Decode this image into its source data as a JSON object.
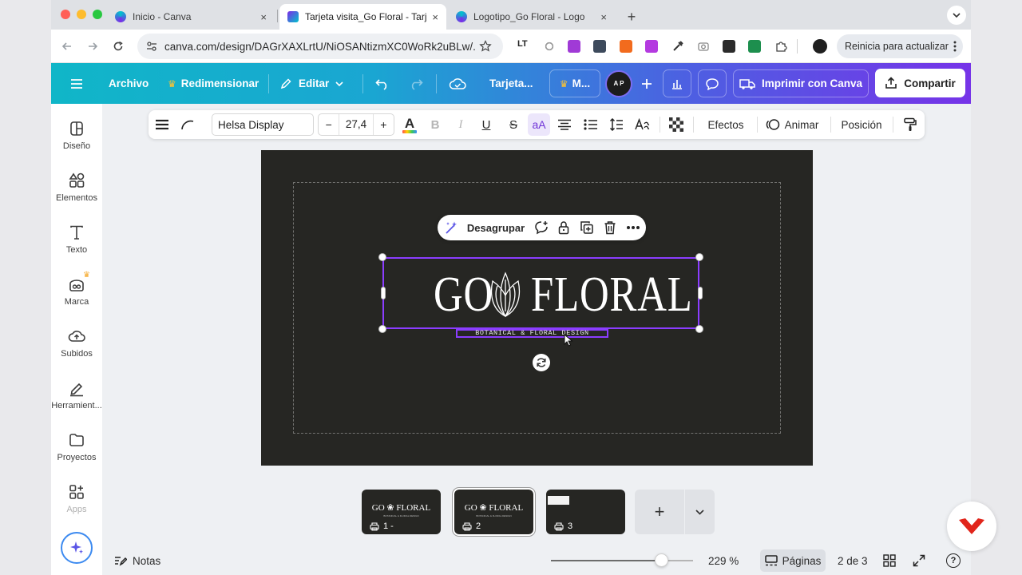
{
  "browser": {
    "tabs": [
      {
        "title": "Inicio - Canva",
        "active": false
      },
      {
        "title": "Tarjeta visita_Go Floral - Tarjeta",
        "active": true
      },
      {
        "title": "Logotipo_Go Floral - Logo",
        "active": false
      }
    ],
    "new_tab": "+",
    "close_glyph": "×",
    "url": "canva.com/design/DAGrXAXLrtU/NiOSANtizmXC0WoRk2uBLw/...",
    "update_label": "Reinicia para actualizar",
    "ext_lt": "LT"
  },
  "canva_header": {
    "menu": "Archivo",
    "resize": "Redimensionar",
    "edit": "Editar",
    "doc_title": "Tarjeta...",
    "premium_short": "M...",
    "avatar": "A P",
    "print": "Imprimir con Canva",
    "share": "Compartir",
    "accent_color": "#8b3dff"
  },
  "sidebar": {
    "items": [
      {
        "label": "Diseño",
        "icon": "layout-icon"
      },
      {
        "label": "Elementos",
        "icon": "elements-icon"
      },
      {
        "label": "Texto",
        "icon": "text-icon"
      },
      {
        "label": "Marca",
        "icon": "brand-icon"
      },
      {
        "label": "Subidos",
        "icon": "upload-cloud-icon"
      },
      {
        "label": "Herramient...",
        "icon": "pen-tool-icon"
      },
      {
        "label": "Proyectos",
        "icon": "folder-icon"
      },
      {
        "label": "Apps",
        "icon": "apps-grid-icon"
      }
    ]
  },
  "toolbar": {
    "font": "Helsa Display",
    "minus": "−",
    "size": "27,4",
    "plus": "+",
    "letter_a": "A",
    "bold": "B",
    "italic": "I",
    "underline": "U",
    "strike": "S",
    "case": "aA",
    "effects": "Efectos",
    "animate": "Animar",
    "position": "Posición"
  },
  "context_menu": {
    "ungroup": "Desagrupar"
  },
  "design": {
    "logo_left": "GO",
    "logo_right": "FLORAL",
    "tagline": "BOTANICAL & FLORAL DESIGN",
    "background": "#262623"
  },
  "pages": {
    "thumbs": [
      {
        "label": "1 -",
        "mini": "GO ❀ FLORAL",
        "selected": false
      },
      {
        "label": "2",
        "mini": "GO ❀ FLORAL",
        "selected": true
      },
      {
        "label": "3",
        "mini": "",
        "selected": false
      }
    ],
    "add": "+"
  },
  "footer": {
    "notes": "Notas",
    "zoom": "229 %",
    "zoom_fraction": 0.78,
    "pages_label": "Páginas",
    "page_count": "2 de 3",
    "help": "?"
  }
}
